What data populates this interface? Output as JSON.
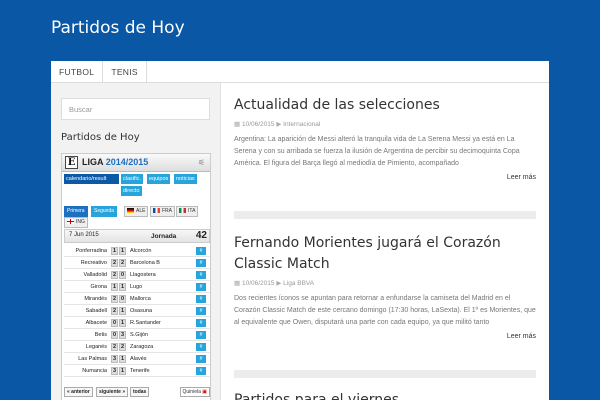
{
  "site": {
    "title": "Partidos de Hoy"
  },
  "nav": {
    "items": [
      "FUTBOL",
      "TENIS"
    ]
  },
  "sidebar": {
    "search_placeholder": "Buscar",
    "widget_title": "Partidos de Hoy",
    "widget": {
      "logo_letter": "E",
      "liga_label": "LIGA",
      "season": "2014/2015",
      "tabs": [
        "calendario/result",
        "clasific.",
        "equipos",
        "noticias",
        "directo"
      ],
      "subtabs": [
        "Primera",
        "Segunda",
        "ALE",
        "FRA",
        "ITA",
        "ING"
      ],
      "date": "7 Jun 2015",
      "jornada_label": "Jornada",
      "jornada_number": "42",
      "matches": [
        {
          "home": "Ponferradina",
          "hs": "1",
          "as": "1",
          "away": "Alcorcón"
        },
        {
          "home": "Recreativo",
          "hs": "2",
          "as": "2",
          "away": "Barcelona B"
        },
        {
          "home": "Valladolid",
          "hs": "2",
          "as": "0",
          "away": "Llagostera"
        },
        {
          "home": "Girona",
          "hs": "1",
          "as": "1",
          "away": "Lugo"
        },
        {
          "home": "Mirandés",
          "hs": "2",
          "as": "0",
          "away": "Mallorca"
        },
        {
          "home": "Sabadell",
          "hs": "2",
          "as": "1",
          "away": "Osasuna"
        },
        {
          "home": "Albacete",
          "hs": "0",
          "as": "1",
          "away": "R.Santander"
        },
        {
          "home": "Betis",
          "hs": "0",
          "as": "3",
          "away": "S.Gijón"
        },
        {
          "home": "Leganés",
          "hs": "2",
          "as": "2",
          "away": "Zaragoza"
        },
        {
          "home": "Las Palmas",
          "hs": "3",
          "as": "1",
          "away": "Alavés"
        },
        {
          "home": "Numancia",
          "hs": "3",
          "as": "1",
          "away": "Tenerife"
        }
      ],
      "match_button": "#",
      "footer": {
        "prev": "« anterior",
        "next": "siguiente »",
        "all": "todas",
        "quiniela": "Quiniela"
      }
    }
  },
  "posts": [
    {
      "title": "Actualidad de las selecciones",
      "date": "10/06/2015",
      "category": "Internacional",
      "excerpt": "Argentina: La aparición de Messi alteró la tranquila vida de La Serena Messi ya está en La Serena y con su arribada se fuerza la ilusión de Argentina de percibir su decimoquinta Copa América. El figura del Barça llegó al mediodía de Pimiento, acompañado",
      "more": "Leer más"
    },
    {
      "title": "Fernando Morientes jugará el Corazón Classic Match",
      "date": "10/06/2015",
      "category": "Liga BBVA",
      "excerpt": "Dos recientes íconos se apuntan para retornar a enfundarse la camiseta del Madrid en el Corazón Classic Match de este cercano domingo (17:30 horas, LaSexta). El 1º es Morientes, que al equivalente que Owen, disputará una parte con cada equipo, ya que militó tanto",
      "more": "Leer más"
    },
    {
      "title": "Partidos para el viernes"
    }
  ],
  "colors": {
    "background": "#0a57a5",
    "accent": "#27a4dc",
    "dark_accent": "#0c5aa6"
  }
}
